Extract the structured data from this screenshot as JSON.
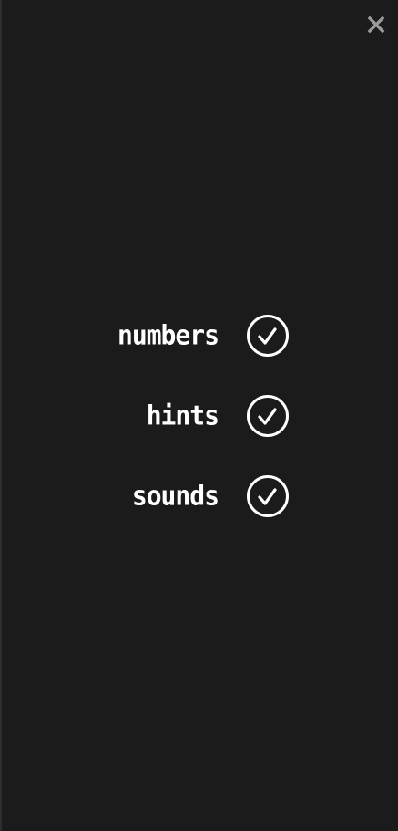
{
  "header": {
    "close_icon": "close-icon"
  },
  "settings": {
    "items": [
      {
        "label": "numbers",
        "checked": true,
        "icon": "checkmark-circle-icon"
      },
      {
        "label": "hints",
        "checked": true,
        "icon": "checkmark-circle-icon"
      },
      {
        "label": "sounds",
        "checked": true,
        "icon": "checkmark-circle-icon"
      }
    ]
  },
  "colors": {
    "background": "#1b1b1b",
    "text": "#ffffff",
    "close_icon": "#9a9a9a"
  }
}
